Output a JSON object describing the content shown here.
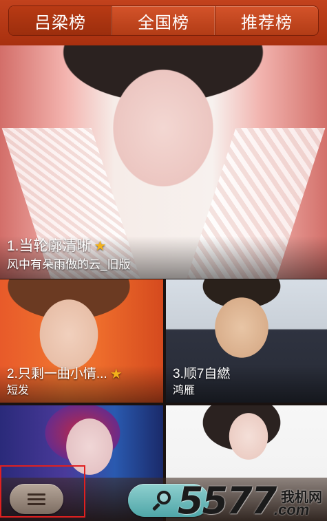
{
  "tabs": [
    {
      "label": "吕梁榜",
      "active": true
    },
    {
      "label": "全国榜",
      "active": false
    },
    {
      "label": "推荐榜",
      "active": false
    }
  ],
  "cards": [
    {
      "title": "1.当轮廓清晰",
      "subtitle": "风中有朵雨做的云_旧版",
      "starred": true
    },
    {
      "title": "2.只剩一曲小情...",
      "subtitle": "短发",
      "starred": true
    },
    {
      "title": "3.顺7自繎",
      "subtitle": "鸿雁",
      "starred": false
    },
    {
      "title": "",
      "subtitle": "",
      "starred": false
    },
    {
      "title": "",
      "subtitle": "",
      "starred": false
    }
  ],
  "bottom_bar": {
    "menu_icon": "hamburger-menu-icon",
    "search_icon": "search-icon"
  },
  "watermark": {
    "number": "5577",
    "chinese": "我机网",
    "domain": ".com"
  },
  "colors": {
    "tab_bar": "#b23c16",
    "star": "#f4b21a",
    "search_button": "#4fa6a8",
    "highlight_box": "#e02020"
  }
}
